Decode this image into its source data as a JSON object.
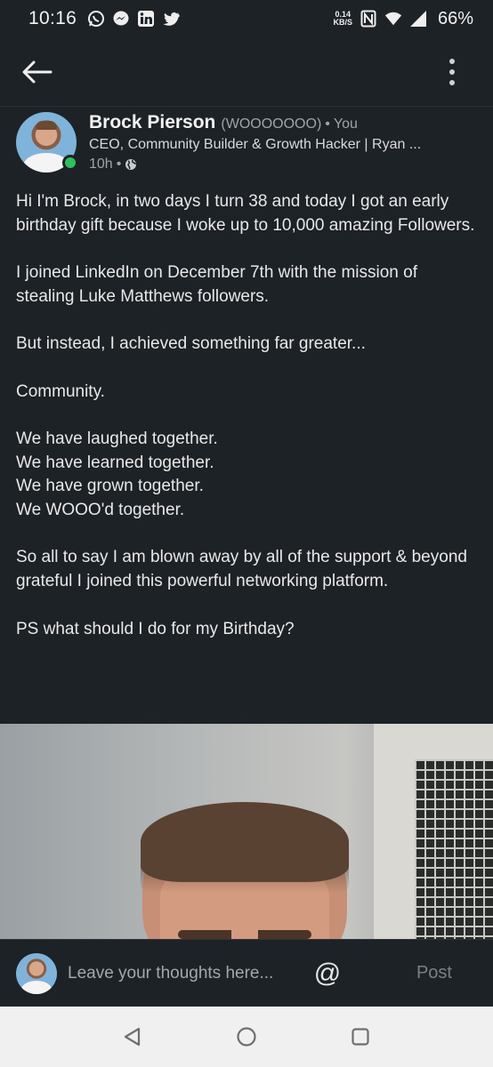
{
  "status_bar": {
    "time": "10:16",
    "left_icons": [
      "whatsapp-icon",
      "messenger-icon",
      "linkedin-icon",
      "twitter-icon"
    ],
    "net_speed_value": "0.14",
    "net_speed_unit": "KB/S",
    "battery": "66%"
  },
  "post": {
    "author_name": "Brock Pierson",
    "author_pronoun": "(WOOOOOOO)",
    "author_separator": "•",
    "author_relation": "You",
    "author_headline": "CEO, Community Builder & Growth Hacker | Ryan ...",
    "time_ago": "10h",
    "meta_separator": "•",
    "online_status_color": "#2fbf5b",
    "paragraphs": [
      "Hi I'm Brock, in two days I turn 38 and today I got an early birthday gift because I woke up to 10,000 amazing Followers.",
      "I joined LinkedIn on December 7th with the mission of stealing Luke Matthews followers.",
      "But instead, I achieved something far greater...",
      "Community.",
      "We have laughed together.\nWe have learned together.\nWe have grown together.\nWe WOOO'd together.",
      "So all to say I am blown away by all of the support & beyond grateful I joined this powerful networking platform.",
      "PS what should I do for my Birthday?"
    ]
  },
  "comment": {
    "placeholder": "Leave your thoughts here...",
    "mention_symbol": "@",
    "post_label": "Post"
  },
  "colors": {
    "background": "#1d2226",
    "nav_background": "#f0f0f0"
  }
}
